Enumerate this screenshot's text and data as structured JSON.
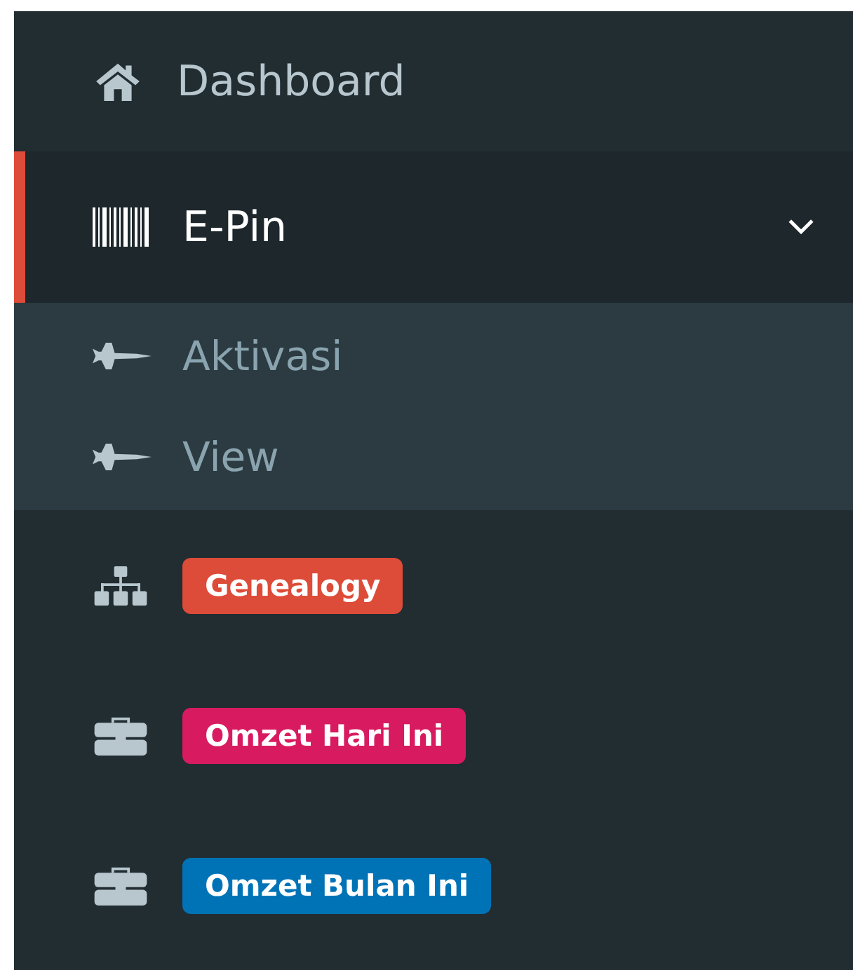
{
  "menu": [
    {
      "kind": "link",
      "label": "Dashboard",
      "selected": false
    },
    {
      "kind": "tree",
      "label": "E-Pin",
      "selected": true,
      "expanded": true,
      "children": [
        {
          "label": "Aktivasi",
          "selected": false
        },
        {
          "label": "View",
          "selected": false
        }
      ]
    },
    {
      "kind": "badge",
      "label": "Genealogy",
      "selected": false,
      "color": "#dd4b39"
    },
    {
      "kind": "badge",
      "label": "Omzet Hari Ini",
      "selected": false,
      "color": "#d81b60"
    },
    {
      "kind": "badge",
      "label": "Omzet Bulan Ini",
      "selected": false,
      "color": "#0073b7"
    }
  ]
}
